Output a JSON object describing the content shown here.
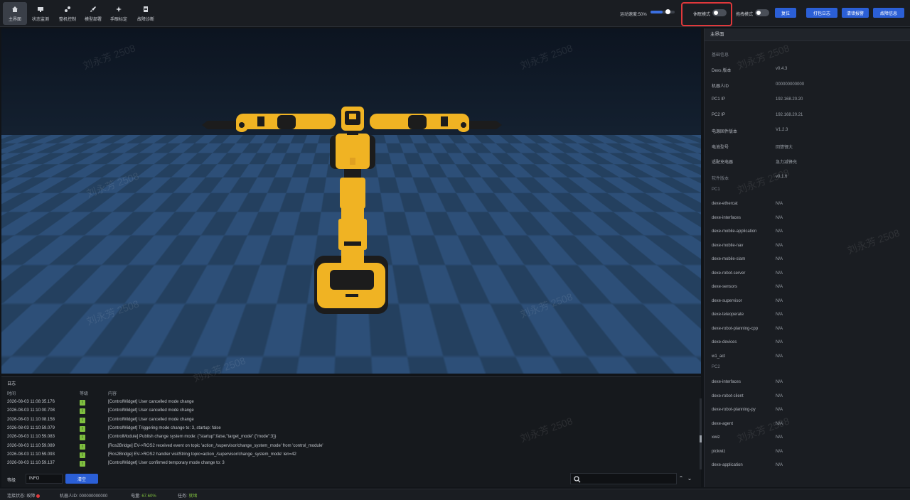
{
  "toolbar": {
    "items": [
      {
        "label": "主界面",
        "icon": "home-icon"
      },
      {
        "label": "状态监测",
        "icon": "monitor-icon"
      },
      {
        "label": "整机控制",
        "icon": "joystick-icon"
      },
      {
        "label": "模型部署",
        "icon": "rocket-icon"
      },
      {
        "label": "手眼标定",
        "icon": "calibrate-icon"
      },
      {
        "label": "故障诊断",
        "icon": "diagnose-icon"
      }
    ],
    "speed_label": "运动速度:50%",
    "speed_value": 0.5,
    "mode1_label": "休眠模式",
    "mode1_on": false,
    "mode2_label": "拖拽模式",
    "mode2_on": false,
    "reset_label": "复位",
    "btn_log": "打包日志",
    "btn_clear_fault": "清错报警",
    "btn_fault_info": "故障信息"
  },
  "right_panel": {
    "title": "主界面",
    "basic_section": "基础信息",
    "basic": [
      {
        "k": "Dexs 版本",
        "v": "v0.4.3"
      },
      {
        "k": "机器人ID",
        "v": "000000000000"
      },
      {
        "k": "PC1 IP",
        "v": "192.168.20.20"
      },
      {
        "k": "PC2 IP",
        "v": "192.168.20.21"
      },
      {
        "k": "电源固件版本",
        "v": "V1.2.3"
      },
      {
        "k": "电池型号",
        "v": "回馈锂大"
      },
      {
        "k": "适配充电器",
        "v": "急力减锋充"
      }
    ],
    "software_section": "软件版本",
    "software_version": "v0.1.6",
    "pc1_label": "PC1",
    "pc1": [
      {
        "k": "dexe-ethercat",
        "v": "N/A"
      },
      {
        "k": "dexe-interfaces",
        "v": "N/A"
      },
      {
        "k": "dexe-mobile-application",
        "v": "N/A"
      },
      {
        "k": "dexe-mobile-nav",
        "v": "N/A"
      },
      {
        "k": "dexe-mobile-slam",
        "v": "N/A"
      },
      {
        "k": "dexe-robot-server",
        "v": "N/A"
      },
      {
        "k": "dexe-sensors",
        "v": "N/A"
      },
      {
        "k": "dexe-supervisor",
        "v": "N/A"
      },
      {
        "k": "dexe-teleoperate",
        "v": "N/A"
      },
      {
        "k": "dexe-robot-planning-cpp",
        "v": "N/A"
      },
      {
        "k": "dexe-devices",
        "v": "N/A"
      },
      {
        "k": "w1_act",
        "v": "N/A"
      }
    ],
    "pc2_label": "PC2",
    "pc2": [
      {
        "k": "dexe-interfaces",
        "v": "N/A"
      },
      {
        "k": "dexe-robot-client",
        "v": "N/A"
      },
      {
        "k": "dexe-robot-planning-py",
        "v": "N/A"
      },
      {
        "k": "dexe-agent",
        "v": "N/A"
      },
      {
        "k": "xwiz",
        "v": "N/A"
      },
      {
        "k": "pickwiz",
        "v": "N/A"
      },
      {
        "k": "dexe-application",
        "v": "N/A"
      }
    ]
  },
  "log": {
    "title": "日志",
    "col_time": "时间",
    "col_level": "等级",
    "col_content": "内容",
    "rows": [
      {
        "time": "2026-08-03 11:08:35.176",
        "level": "I",
        "content": "[ControlWidget] User cancelled mode change"
      },
      {
        "time": "2026-08-03 11:10:00.708",
        "level": "I",
        "content": "[ControlWidget] User cancelled mode change"
      },
      {
        "time": "2026-08-03 11:10:08.158",
        "level": "I",
        "content": "[ControlWidget] User cancelled mode change"
      },
      {
        "time": "2026-08-03 11:10:59.079",
        "level": "I",
        "content": "[ControlWidget] Triggering mode change to: 3, startup: false"
      },
      {
        "time": "2026-08-03 11:10:59.083",
        "level": "I",
        "content": "[ControlModule] Publish change system mode: {\"startup\":false,\"target_mode\":{\"mode\":3}}"
      },
      {
        "time": "2026-08-03 11:10:59.089",
        "level": "I",
        "content": "[Ros2Bridge] EV->ROS2 received event on topic 'action_/supervisor/change_system_mode' from 'control_module'"
      },
      {
        "time": "2026-08-03 11:10:59.093",
        "level": "I",
        "content": "[Ros2Bridge] EV->ROS2 handler visitString topic=action_/supervisor/change_system_mode' len=42"
      },
      {
        "time": "2026-08-03 11:10:59.137",
        "level": "I",
        "content": "[ControlWidget] User confirmed temporary mode change to: 3"
      }
    ],
    "filter_label": "等级",
    "filter_value": "INFO",
    "clear_label": "清空",
    "search_placeholder": ""
  },
  "status": {
    "conn_label": "连接状态:",
    "conn_value": "故障",
    "robot_id_label": "机器人ID:",
    "robot_id_value": "000000000000",
    "battery_label": "电量:",
    "battery_value": "67.60%",
    "task_label": "任务:",
    "task_value": "就绪"
  },
  "watermark": "刘永芳 2508",
  "colors": {
    "accent": "#2b5fd6",
    "alert": "#e0383b",
    "ok": "#7fbf3f",
    "robot": "#f0b323"
  }
}
